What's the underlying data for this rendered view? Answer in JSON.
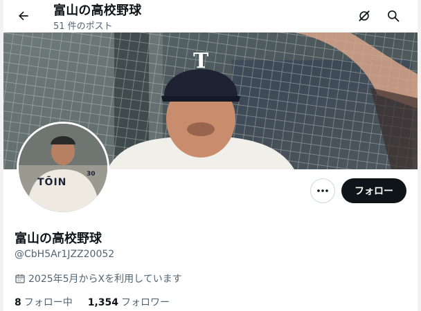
{
  "header": {
    "title": "富山の高校野球",
    "post_count": "51 件のポスト"
  },
  "icons": {
    "back": "arrow-left-icon",
    "grok": "grok-icon",
    "search": "search-icon",
    "more": "more-dots-icon",
    "calendar": "calendar-icon"
  },
  "banner": {
    "cap_letter": "T"
  },
  "avatar": {
    "jersey_text": "TŌIN",
    "number": "30"
  },
  "actions": {
    "follow_label": "フォロー"
  },
  "profile": {
    "name": "富山の高校野球",
    "handle": "@CbH5Ar1JZZ20052",
    "joined": "2025年5月からXを利用しています",
    "following_count": "8",
    "following_label": "フォロー中",
    "followers_count": "1,354",
    "followers_label": "フォロワー"
  },
  "colors": {
    "text_primary": "#0f1419",
    "text_secondary": "#536471",
    "button_dark": "#0f1419",
    "border": "#cfd9de"
  }
}
